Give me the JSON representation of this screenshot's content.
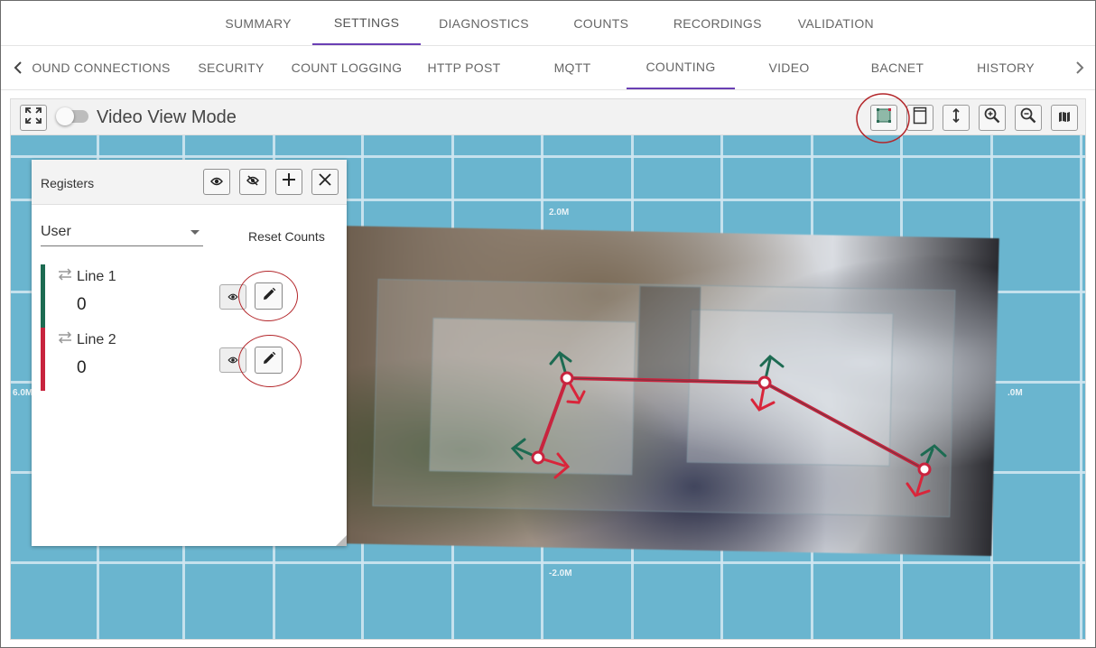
{
  "top_tabs": [
    {
      "label": "SUMMARY",
      "active": false
    },
    {
      "label": "SETTINGS",
      "active": true
    },
    {
      "label": "DIAGNOSTICS",
      "active": false
    },
    {
      "label": "COUNTS",
      "active": false
    },
    {
      "label": "RECORDINGS",
      "active": false
    },
    {
      "label": "VALIDATION",
      "active": false
    }
  ],
  "sub_tabs": [
    {
      "label": "OUND CONNECTIONS",
      "active": false
    },
    {
      "label": "SECURITY",
      "active": false
    },
    {
      "label": "COUNT LOGGING",
      "active": false
    },
    {
      "label": "HTTP POST",
      "active": false
    },
    {
      "label": "MQTT",
      "active": false
    },
    {
      "label": "COUNTING",
      "active": true
    },
    {
      "label": "VIDEO",
      "active": false
    },
    {
      "label": "BACNET",
      "active": false
    },
    {
      "label": "HISTORY",
      "active": false
    }
  ],
  "toolbar": {
    "video_view_mode_label": "Video View Mode",
    "video_view_mode_on": false,
    "icons": [
      "fullscreen-icon",
      "region-select-icon",
      "panel-toggle-icon",
      "height-icon",
      "zoom-in-icon",
      "zoom-out-icon",
      "map-icon"
    ]
  },
  "scale_labels": {
    "top": "2.0M",
    "bottom": "-2.0M",
    "left": "6.0M",
    "right": ".0M"
  },
  "registers": {
    "title": "Registers",
    "filter_value": "User",
    "reset_label": "Reset Counts",
    "items": [
      {
        "name": "Line 1",
        "count": "0",
        "color": "#1d6b52"
      },
      {
        "name": "Line 2",
        "count": "0",
        "color": "#c8243e"
      }
    ]
  },
  "colors": {
    "accent": "#6a3fb4",
    "line": "#c8243e",
    "arrow_in": "#1d6b52",
    "arrow_out": "#d9253a",
    "annotation_ring": "#b3262a",
    "canvas": "#6ab5cf"
  }
}
